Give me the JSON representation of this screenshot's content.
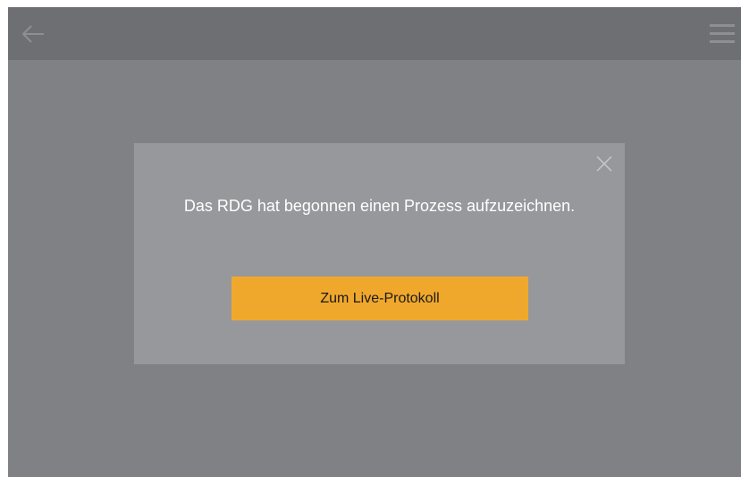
{
  "topbar": {
    "back_icon": "arrow-left-icon",
    "menu_icon": "hamburger-menu-icon"
  },
  "dialog": {
    "close_icon": "close-icon",
    "message": "Das RDG hat begonnen einen Prozess aufzuzeichnen.",
    "action_label": "Zum Live-Protokoll"
  },
  "colors": {
    "overlay_background": "#808184",
    "topbar_background": "#6e6f72",
    "dialog_background": "#97989b",
    "accent": "#f0a82c"
  }
}
